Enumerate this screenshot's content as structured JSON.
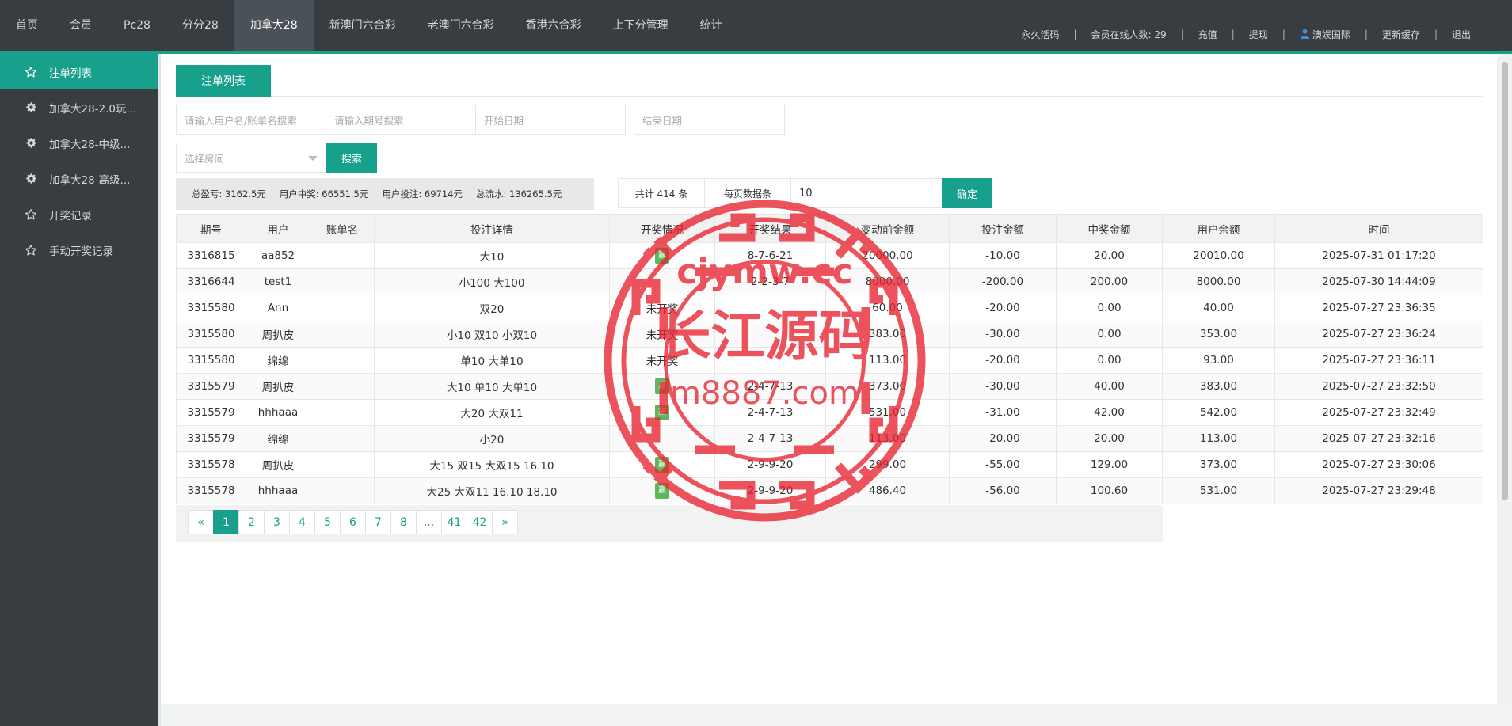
{
  "nav": {
    "items": [
      "首页",
      "会员",
      "Pc28",
      "分分28",
      "加拿大28",
      "新澳门六合彩",
      "老澳门六合彩",
      "香港六合彩",
      "上下分管理",
      "统计"
    ],
    "active_index": 4,
    "right": {
      "permanent_code": "永久活码",
      "online_label": "会员在线人数: 29",
      "recharge": "充值",
      "withdraw": "提现",
      "username": "澳娱国际",
      "refresh_cache": "更新缓存",
      "logout": "退出"
    }
  },
  "sidebar": {
    "items": [
      {
        "label": "注单列表",
        "icon": "star-icon"
      },
      {
        "label": "加拿大28-2.0玩...",
        "icon": "gear-icon"
      },
      {
        "label": "加拿大28-中级...",
        "icon": "gear-icon"
      },
      {
        "label": "加拿大28-高级...",
        "icon": "gear-icon"
      },
      {
        "label": "开奖记录",
        "icon": "star-icon"
      },
      {
        "label": "手动开奖记录",
        "icon": "star-icon"
      }
    ],
    "active_index": 0
  },
  "main": {
    "tab_label": "注单列表",
    "filters": {
      "user_placeholder": "请输入用户名/账单名搜索",
      "period_placeholder": "请输入期号搜索",
      "start_placeholder": "开始日期",
      "date_sep": "-",
      "end_placeholder": "结束日期",
      "room_placeholder": "选择房间",
      "search_label": "搜索"
    },
    "stats": {
      "profit": "总盈亏: 3162.5元",
      "user_win": "用户中奖: 66551.5元",
      "user_bet": "用户投注: 69714元",
      "turnover": "总流水: 136265.5元"
    },
    "paging": {
      "total": "共计 414 条",
      "per_page_label": "每页数据条",
      "per_page_value": "10",
      "confirm": "确定"
    },
    "table": {
      "columns": [
        "期号",
        "用户",
        "账单名",
        "投注详情",
        "开奖情况",
        "开奖结果",
        "变动前金额",
        "投注金额",
        "中奖金额",
        "用户余额",
        "时间"
      ],
      "rows": [
        {
          "period": "3316815",
          "user": "aa852",
          "bill": "",
          "detail": "大10",
          "status": "赢",
          "result": "8-7-6-21",
          "before": "20000.00",
          "bet": "-10.00",
          "win": "20.00",
          "balance": "20010.00",
          "time": "2025-07-31 01:17:20"
        },
        {
          "period": "3316644",
          "user": "test1",
          "bill": "",
          "detail": "小100 大100",
          "status": "",
          "result": "2-2-3-7",
          "before": "8000.00",
          "bet": "-200.00",
          "win": "200.00",
          "balance": "8000.00",
          "time": "2025-07-30 14:44:09"
        },
        {
          "period": "3315580",
          "user": "Ann",
          "bill": "",
          "detail": "双20",
          "status": "未开奖",
          "result": "",
          "before": "60.00",
          "bet": "-20.00",
          "win": "0.00",
          "balance": "40.00",
          "time": "2025-07-27 23:36:35"
        },
        {
          "period": "3315580",
          "user": "周扒皮",
          "bill": "",
          "detail": "小10 双10 小双10",
          "status": "未开奖",
          "result": "",
          "before": "383.00",
          "bet": "-30.00",
          "win": "0.00",
          "balance": "353.00",
          "time": "2025-07-27 23:36:24"
        },
        {
          "period": "3315580",
          "user": "绵绵",
          "bill": "",
          "detail": "单10 大单10",
          "status": "未开奖",
          "result": "",
          "before": "113.00",
          "bet": "-20.00",
          "win": "0.00",
          "balance": "93.00",
          "time": "2025-07-27 23:36:11"
        },
        {
          "period": "3315579",
          "user": "周扒皮",
          "bill": "",
          "detail": "大10 单10 大单10",
          "status": "赢",
          "result": "2-4-7-13",
          "before": "373.00",
          "bet": "-30.00",
          "win": "40.00",
          "balance": "383.00",
          "time": "2025-07-27 23:32:50"
        },
        {
          "period": "3315579",
          "user": "hhhaaa",
          "bill": "",
          "detail": "大20 大双11",
          "status": "赢",
          "result": "2-4-7-13",
          "before": "531.00",
          "bet": "-31.00",
          "win": "42.00",
          "balance": "542.00",
          "time": "2025-07-27 23:32:49"
        },
        {
          "period": "3315579",
          "user": "绵绵",
          "bill": "",
          "detail": "小20",
          "status": "",
          "result": "2-4-7-13",
          "before": "113.00",
          "bet": "-20.00",
          "win": "20.00",
          "balance": "113.00",
          "time": "2025-07-27 23:32:16"
        },
        {
          "period": "3315578",
          "user": "周扒皮",
          "bill": "",
          "detail": "大15 双15 大双15 16.10",
          "status": "赢",
          "result": "2-9-9-20",
          "before": "299.00",
          "bet": "-55.00",
          "win": "129.00",
          "balance": "373.00",
          "time": "2025-07-27 23:30:06"
        },
        {
          "period": "3315578",
          "user": "hhhaaa",
          "bill": "",
          "detail": "大25 大双11 16.10 18.10",
          "status": "赢",
          "result": "2-9-9-20",
          "before": "486.40",
          "bet": "-56.00",
          "win": "100.60",
          "balance": "531.00",
          "time": "2025-07-27 23:29:48"
        }
      ]
    },
    "pager": [
      "«",
      "1",
      "2",
      "3",
      "4",
      "5",
      "6",
      "7",
      "8",
      "...",
      "41",
      "42",
      "»"
    ],
    "pager_active": "1"
  },
  "watermark": {
    "line1": "cjymw.cc",
    "line2": "长江源码",
    "line3": "m8887.com"
  },
  "colors": {
    "accent": "#17a08c",
    "nav_bg": "#373d41",
    "win_badge": "#5cb85c",
    "stamp_red": "#e8232f"
  }
}
